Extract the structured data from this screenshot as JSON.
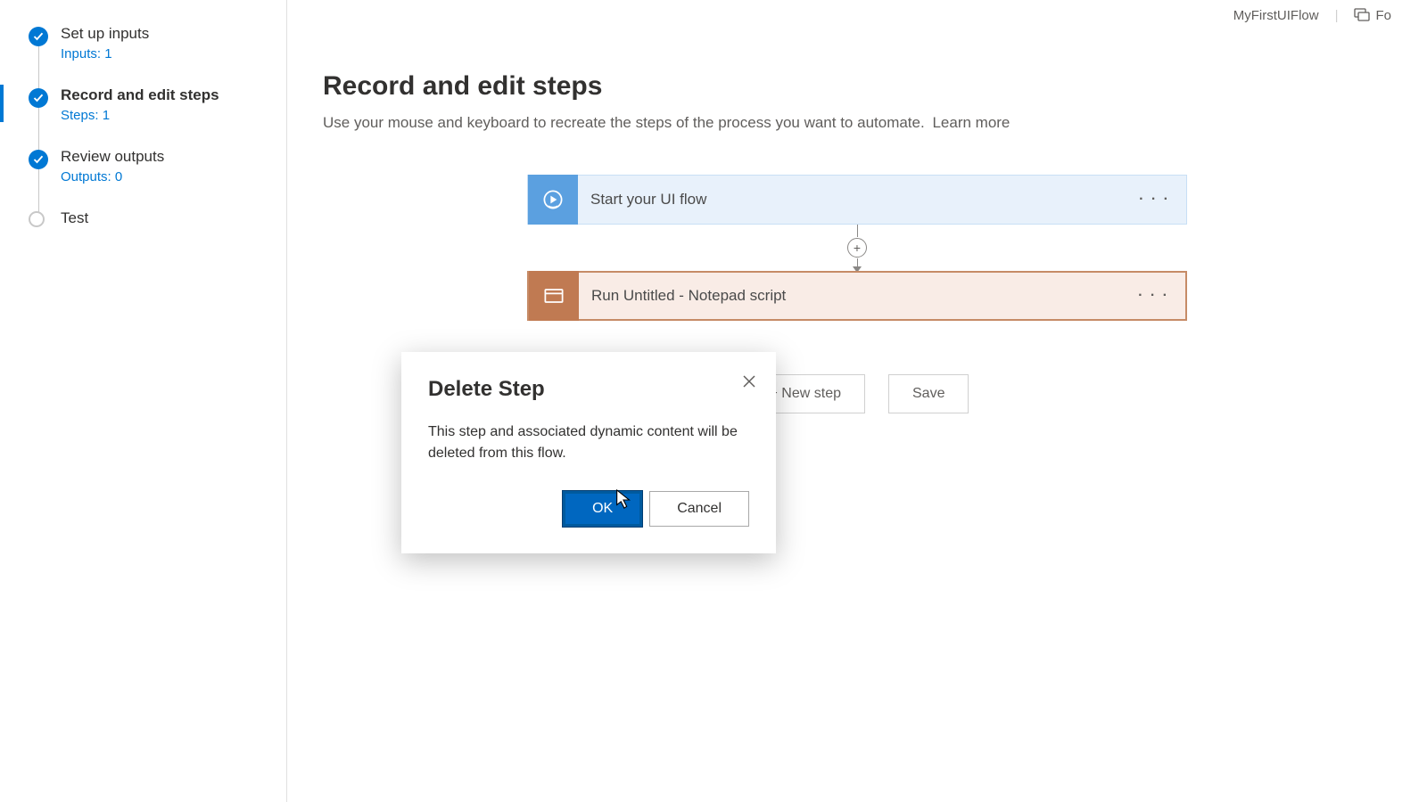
{
  "topbar": {
    "flow_name": "MyFirstUIFlow",
    "feedback_partial": "Fo"
  },
  "sidebar": {
    "items": [
      {
        "title": "Set up inputs",
        "sub": "Inputs: 1",
        "state": "done"
      },
      {
        "title": "Record and edit steps",
        "sub": "Steps: 1",
        "state": "done",
        "active": true
      },
      {
        "title": "Review outputs",
        "sub": "Outputs: 0",
        "state": "done"
      },
      {
        "title": "Test",
        "sub": "",
        "state": "empty"
      }
    ]
  },
  "page": {
    "heading": "Record and edit steps",
    "description": "Use your mouse and keyboard to recreate the steps of the process you want to automate.",
    "learn_more": "Learn more"
  },
  "flow": {
    "start_label": "Start your UI flow",
    "run_label": "Run Untitled - Notepad script",
    "ellipsis": "· · ·"
  },
  "buttons": {
    "new_step": "+ New step",
    "save": "Save"
  },
  "dialog": {
    "title": "Delete Step",
    "body": "This step and associated dynamic content will be deleted from this flow.",
    "ok": "OK",
    "cancel": "Cancel"
  }
}
